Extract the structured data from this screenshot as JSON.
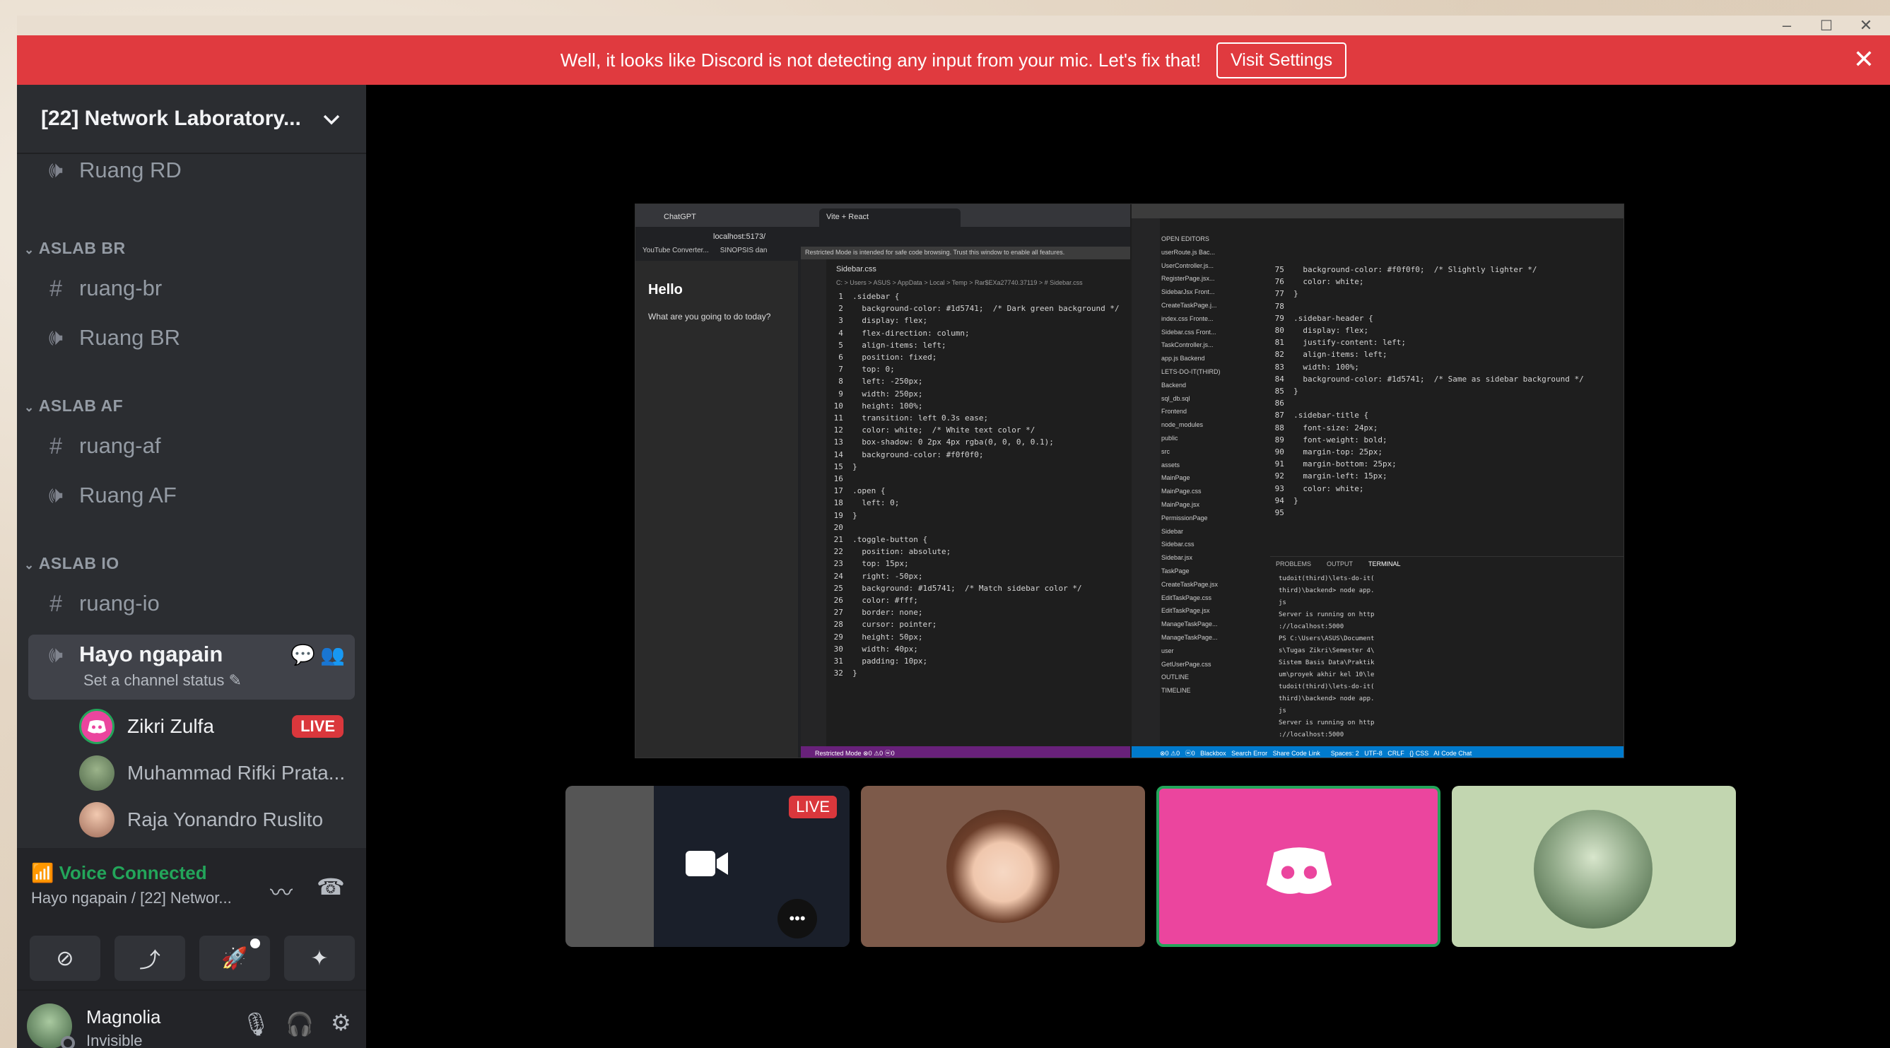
{
  "colors": {
    "banner": "#e03a3f",
    "sidebar": "#2b2d31",
    "live": "#da373c",
    "voice_connected": "#23a55a",
    "discord_tile": "#eb459e",
    "green_tile": "#c2d6b0",
    "brown_tile": "#7d5a4a"
  },
  "banner": {
    "message": "Well, it looks like Discord is not detecting any input from your mic. Let's fix that!",
    "button": "Visit Settings",
    "close_icon": "close-icon"
  },
  "window_controls": {
    "minimize": "–",
    "maximize": "☐",
    "close": "✕"
  },
  "server": {
    "name": "[22] Network Laboratory...",
    "chevron": "⌄"
  },
  "channels": {
    "partial": {
      "name": "Ruang RD",
      "icon": "speaker-icon"
    },
    "cat_br": "ASLAB BR",
    "br_text": "ruang-br",
    "br_voice": "Ruang BR",
    "cat_af": "ASLAB AF",
    "af_text": "ruang-af",
    "af_voice": "Ruang AF",
    "cat_io": "ASLAB IO",
    "io_text": "ruang-io",
    "active": {
      "name": "Hayo ngapain",
      "status": "Set a channel status"
    }
  },
  "voice_users": [
    {
      "name": "Zikri Zulfa",
      "live": "LIVE"
    },
    {
      "name": "Muhammad Rifki Prata..."
    },
    {
      "name": "Raja Yonandro Ruslito"
    }
  ],
  "voice": {
    "title": "Voice Connected",
    "subtitle": "Hayo ngapain / [22] Networ..."
  },
  "user": {
    "name": "Magnolia",
    "status": "Invisible"
  },
  "stream": {
    "browser_tabs": [
      "ChatGPT",
      "Vite + React"
    ],
    "address": "localhost:5173/",
    "bookmarks": [
      "YouTube Converter...",
      "SINOPSIS dan"
    ],
    "hello": "Hello",
    "question": "What are you going to do today?",
    "restricted": "Restricted Mode is intended for safe code browsing. Trust this window to enable all features.",
    "editor_tab": "Sidebar.css",
    "breadcrumb": "C: > Users > ASUS > AppData > Local > Temp > Rar$EXa27740.37119 > # Sidebar.css",
    "code_left": [
      "  1  .sidebar {",
      "  2    background-color: #1d5741;  /* Dark green background */",
      "  3    display: flex;",
      "  4    flex-direction: column;",
      "  5    align-items: left;",
      "  6    position: fixed;",
      "  7    top: 0;",
      "  8    left: -250px;",
      "  9    width: 250px;",
      " 10    height: 100%;",
      " 11    transition: left 0.3s ease;",
      " 12    color: white;  /* White text color */",
      " 13    box-shadow: 0 2px 4px rgba(0, 0, 0, 0.1);",
      " 14    background-color: #f0f0f0;",
      " 15  }",
      " 16",
      " 17  .open {",
      " 18    left: 0;",
      " 19  }",
      " 20",
      " 21  .toggle-button {",
      " 22    position: absolute;",
      " 23    top: 15px;",
      " 24    right: -50px;",
      " 25    background: #1d5741;  /* Match sidebar color */",
      " 26    color: #fff;",
      " 27    border: none;",
      " 28    cursor: pointer;",
      " 29    height: 50px;",
      " 30    width: 40px;",
      " 31    padding: 10px;",
      " 32  }"
    ],
    "code_right": [
      " 75    background-color: #f0f0f0;  /* Slightly lighter */",
      " 76    color: white;",
      " 77  }",
      " 78",
      " 79  .sidebar-header {",
      " 80    display: flex;",
      " 81    justify-content: left;",
      " 82    align-items: left;",
      " 83    width: 100%;",
      " 84    background-color: #1d5741;  /* Same as sidebar background */",
      " 85  }",
      " 86",
      " 87  .sidebar-title {",
      " 88    font-size: 24px;",
      " 89    font-weight: bold;",
      " 90    margin-top: 25px;",
      " 91    margin-bottom: 25px;",
      " 92    margin-left: 15px;",
      " 93    color: white;",
      " 94  }",
      " 95"
    ],
    "explorer": [
      "OPEN EDITORS",
      "userRoute.js Bac...",
      "UserController.js...",
      "RegisterPage.jsx...",
      "SidebarJsx Front...",
      "CreateTaskPage.j...",
      "index.css Fronte...",
      "Sidebar.css Front...",
      "TaskController.js...",
      "app.js Backend",
      "LETS-DO-IT(THIRD)",
      "Backend",
      "sql_db.sql",
      "Frontend",
      "node_modules",
      "public",
      "src",
      "assets",
      "MainPage",
      "MainPage.css",
      "MainPage.jsx",
      "PermissionPage",
      "Sidebar",
      "Sidebar.css",
      "Sidebar.jsx",
      "TaskPage",
      "CreateTaskPage.jsx",
      "EditTaskPage.css",
      "EditTaskPage.jsx",
      "ManageTaskPage...",
      "ManageTaskPage...",
      "user",
      "GetUserPage.css",
      "OUTLINE",
      "TIMELINE"
    ],
    "terminal": [
      "tudoit(third)\\lets-do-it(",
      "third)\\backend> node app.",
      "js",
      "Server is running on http",
      "://localhost:5000",
      "PS C:\\Users\\ASUS\\Document",
      "s\\Tugas Zikri\\Semester 4\\",
      "Sistem Basis Data\\Praktik",
      "um\\proyek akhir kel 10\\le",
      "tudoit(third)\\lets-do-it(",
      "third)\\backend> node app.",
      "js",
      "Server is running on http",
      "://localhost:5000"
    ],
    "terminal_tabs": [
      "PROBLEMS",
      "OUTPUT",
      "TERMINAL"
    ],
    "statusbar": "Restricted Mode   ⊗0 ⚠0   ⓦ0",
    "vs_statusbar": "⊗0 ⚠0   ⓦ0   Blackbox   Search Error   Share Code Link      Spaces: 2   UTF-8   CRLF   {} CSS   AI Code Chat"
  },
  "tiles": [
    {
      "kind": "stream",
      "live": "LIVE",
      "more": "•••"
    },
    {
      "kind": "avatar",
      "bg": "#7d5a4a"
    },
    {
      "kind": "discord",
      "bg": "#eb459e"
    },
    {
      "kind": "avatar",
      "bg": "#c2d6b0"
    }
  ]
}
